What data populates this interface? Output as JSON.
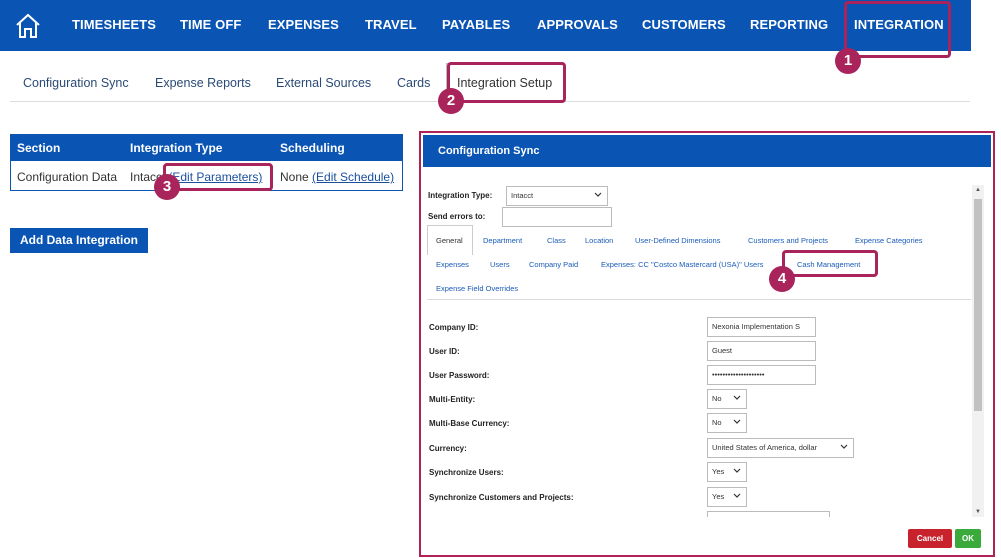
{
  "nav": {
    "items": [
      "TIMESHEETS",
      "TIME OFF",
      "EXPENSES",
      "TRAVEL",
      "PAYABLES",
      "APPROVALS",
      "CUSTOMERS",
      "REPORTING",
      "INTEGRATION"
    ],
    "home_icon": "home-icon",
    "color": "#0a54b4"
  },
  "subtabs": {
    "items": [
      "Configuration Sync",
      "Expense Reports",
      "External Sources",
      "Cards",
      "Integration Setup"
    ],
    "active": "Integration Setup"
  },
  "integrations": {
    "headers": [
      "Section",
      "Integration Type",
      "Scheduling"
    ],
    "row": {
      "section": "Configuration Data",
      "type_prefix": "Intacct",
      "edit_params": "(Edit Parameters)",
      "schedule_prefix": "None",
      "edit_schedule": "(Edit Schedule)"
    },
    "add_button": "Add Data Integration"
  },
  "modal": {
    "title": "Configuration Sync",
    "integration_type_label": "Integration Type:",
    "integration_type_value": "Intacct",
    "send_errors_label": "Send errors to:",
    "send_errors_value": "",
    "tabs_row1": [
      "General",
      "Department",
      "Class",
      "Location",
      "User-Defined Dimensions",
      "Customers and Projects",
      "Expense Categories"
    ],
    "tabs_row2": [
      "Expenses",
      "Users",
      "Company Paid",
      "Expenses: CC \"Costco Mastercard (USA)\" Users",
      "Cash Management"
    ],
    "tabs_row3": [
      "Expense Field Overrides"
    ],
    "active_tab": "General",
    "fields": [
      {
        "label": "Company ID:",
        "value": "Nexonia Implementation S",
        "kind": "input"
      },
      {
        "label": "User ID:",
        "value": "Guest",
        "kind": "input"
      },
      {
        "label": "User Password:",
        "value": "••••••••••••••••••••",
        "kind": "input"
      },
      {
        "label": "Multi-Entity:",
        "value": "No",
        "kind": "select"
      },
      {
        "label": "Multi-Base Currency:",
        "value": "No",
        "kind": "select"
      },
      {
        "label": "Currency:",
        "value": "United States of America, dollar",
        "kind": "select"
      },
      {
        "label": "Synchronize Users:",
        "value": "Yes",
        "kind": "select"
      },
      {
        "label": "Synchronize Customers and Projects:",
        "value": "Yes",
        "kind": "select"
      }
    ],
    "cancel_label": "Cancel",
    "ok_label": "OK"
  },
  "callouts": [
    "1",
    "2",
    "3",
    "4"
  ],
  "colors": {
    "accent": "#a8245a",
    "cancel": "#c8232c",
    "ok": "#3aaa3a"
  }
}
